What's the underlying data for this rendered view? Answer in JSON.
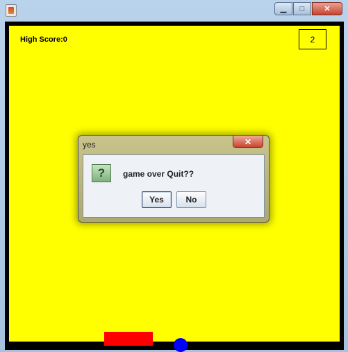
{
  "window": {
    "caption_buttons": {
      "minimize": "▁",
      "maximize": "□",
      "close": "✕"
    }
  },
  "game": {
    "high_score_label": "High Score:0",
    "level": "2",
    "colors": {
      "background": "#ffff00",
      "paddle": "#ff0000",
      "ball": "#0000ff",
      "border": "#000000"
    }
  },
  "dialog": {
    "title": "yes",
    "close_glyph": "✕",
    "icon_glyph": "?",
    "message": "game over Quit??",
    "yes_label": "Yes",
    "no_label": "No"
  }
}
